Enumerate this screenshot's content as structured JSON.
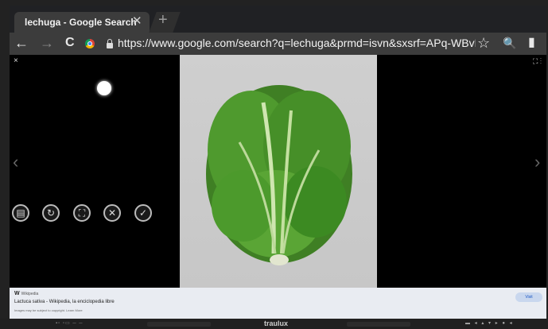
{
  "tab": {
    "title": "lechuga - Google Search",
    "close_glyph": "✕",
    "new_tab_glyph": "+"
  },
  "toolbar": {
    "url": "https://www.google.com/search?q=lechuga&prmd=isvn&sxsrf=APq-WBvDjJgkl",
    "back": "←",
    "forward": "→",
    "reload": "C",
    "star": "☆",
    "search": "🔍",
    "bookmark": "▮"
  },
  "viewer": {
    "close_glyph": "×",
    "top_icons": "⛶ ⋮",
    "prev_glyph": "‹",
    "next_glyph": "›",
    "tools": [
      {
        "name": "screenshot-tool-icon",
        "glyph": "▤"
      },
      {
        "name": "rotate-tool-icon",
        "glyph": "↻"
      },
      {
        "name": "crop-tool-icon",
        "glyph": "⛶"
      },
      {
        "name": "cancel-tool-icon",
        "glyph": "✕"
      },
      {
        "name": "confirm-tool-icon",
        "glyph": "✓"
      }
    ]
  },
  "result": {
    "source_glyph": "W",
    "source": "Wikipedia",
    "title": "Lactuca sativa - Wikipedia, la enciclopedia libre",
    "copyright": "Images may be subject to copyright. Learn More",
    "visit_label": "Visit"
  },
  "bezel": {
    "brand": "traulux",
    "left_controls": "▪▫ ▫▭ ─ ─",
    "right_controls": "▬ ◂ ▴ ▾ ▸ ● ◂"
  },
  "colors": {
    "lettuce": "#4f8f2c",
    "photo_bg": "#cbcbcb",
    "accent": "#1a56c4"
  }
}
